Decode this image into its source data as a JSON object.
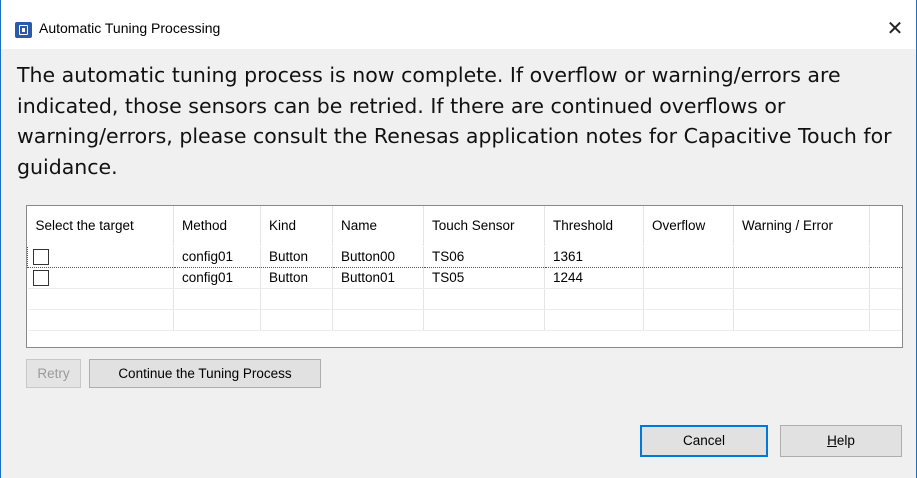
{
  "window": {
    "title": "Automatic Tuning Processing",
    "close_glyph": "✕"
  },
  "message": "The automatic tuning process is now complete. If overflow or warning/errors are indicated, those sensors can be retried. If there are continued overflows or warning/errors, please consult the Renesas application notes for Capacitive Touch for guidance.",
  "table": {
    "columns": [
      "Select the target",
      "Method",
      "Kind",
      "Name",
      "Touch Sensor",
      "Threshold",
      "Overflow",
      "Warning / Error"
    ],
    "rows": [
      {
        "checked": false,
        "method": "config01",
        "kind": "Button",
        "name": "Button00",
        "touch_sensor": "TS06",
        "threshold": "1361",
        "overflow": "",
        "warning": ""
      },
      {
        "checked": false,
        "method": "config01",
        "kind": "Button",
        "name": "Button01",
        "touch_sensor": "TS05",
        "threshold": "1244",
        "overflow": "",
        "warning": ""
      }
    ]
  },
  "buttons": {
    "retry": "Retry",
    "continue": "Continue the Tuning Process",
    "cancel": "Cancel",
    "help_mnemonic": "H",
    "help_rest": "elp"
  },
  "icons": {
    "app": "chip-icon",
    "close": "close-icon",
    "checkbox": "checkbox-icon"
  }
}
